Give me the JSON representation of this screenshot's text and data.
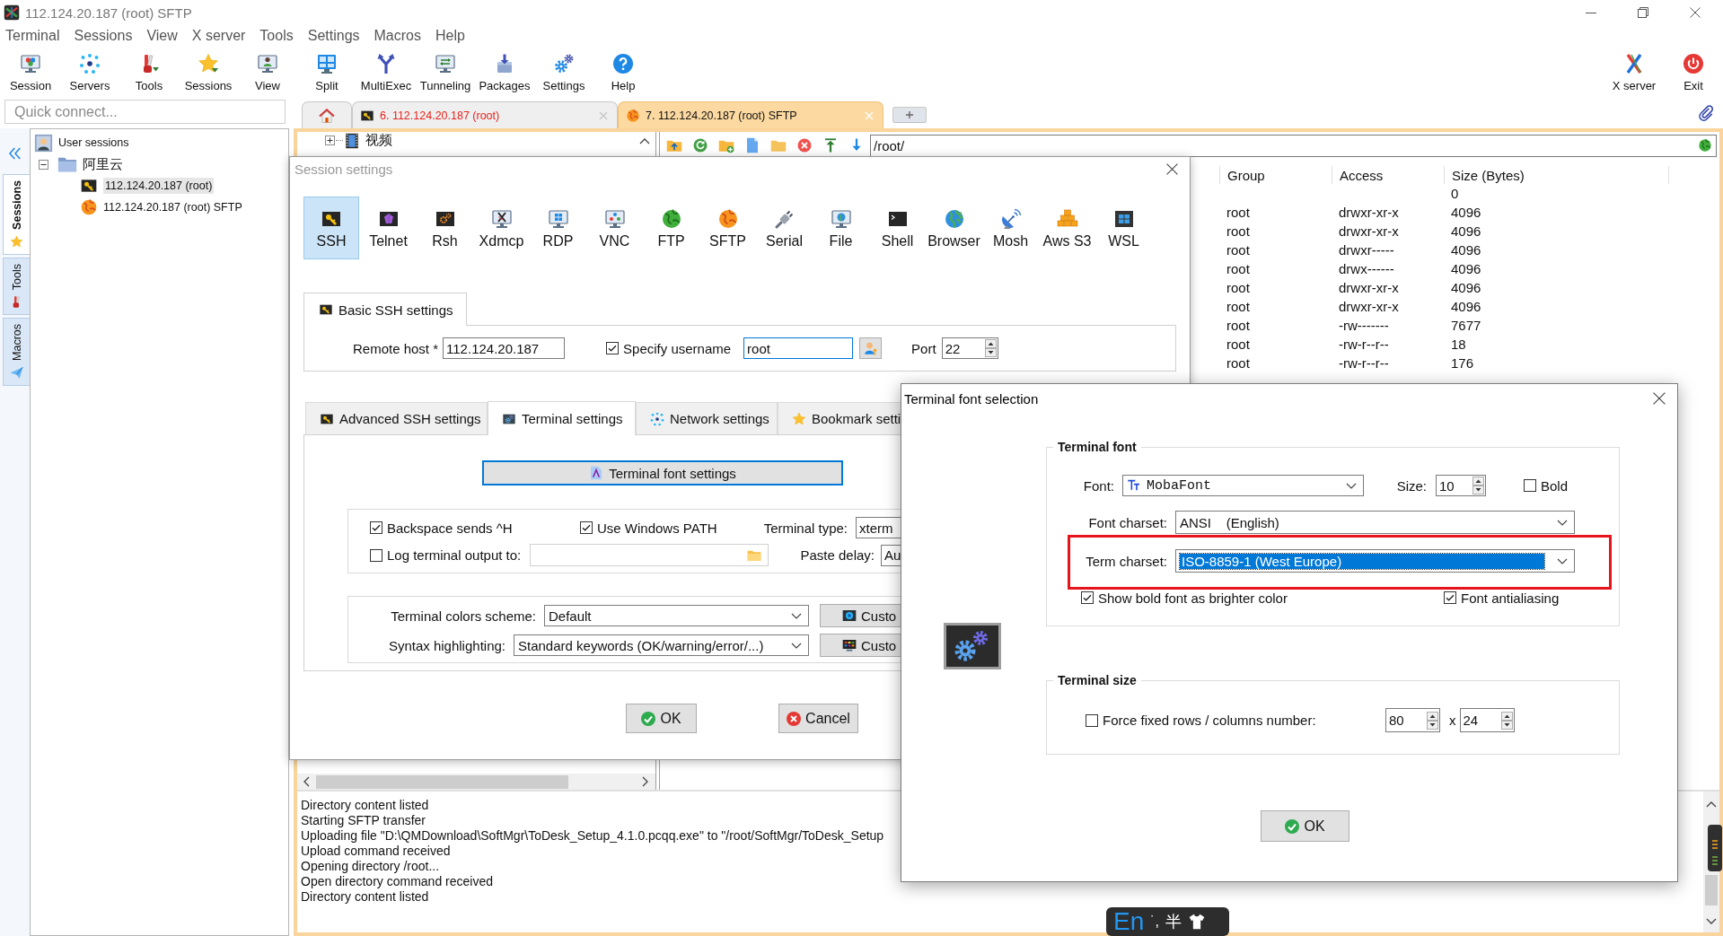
{
  "window": {
    "title": "112.124.20.187 (root) SFTP"
  },
  "menu": [
    "Terminal",
    "Sessions",
    "View",
    "X server",
    "Tools",
    "Settings",
    "Macros",
    "Help"
  ],
  "toolbar": [
    {
      "label": "Session",
      "kind": "session"
    },
    {
      "label": "Servers",
      "kind": "servers"
    },
    {
      "label": "Tools",
      "kind": "tools"
    },
    {
      "label": "Sessions",
      "kind": "sessions"
    },
    {
      "label": "View",
      "kind": "view"
    },
    {
      "label": "Split",
      "kind": "split"
    },
    {
      "label": "MultiExec",
      "kind": "multiexec"
    },
    {
      "label": "Tunneling",
      "kind": "tunneling"
    },
    {
      "label": "Packages",
      "kind": "packages"
    },
    {
      "label": "Settings",
      "kind": "settings"
    },
    {
      "label": "Help",
      "kind": "help"
    }
  ],
  "toolbar_right": [
    {
      "label": "X server",
      "kind": "xserver"
    },
    {
      "label": "Exit",
      "kind": "exit"
    }
  ],
  "quick_connect": {
    "placeholder": "Quick connect..."
  },
  "tabs": [
    {
      "kind": "home",
      "selected": false
    },
    {
      "kind": "ssh",
      "label": "6. 112.124.20.187 (root)",
      "color": "#e8231c",
      "selected": false
    },
    {
      "kind": "sftp",
      "label": "7. 112.124.20.187 (root) SFTP",
      "selected": true
    },
    {
      "kind": "new",
      "selected": false
    }
  ],
  "side_tabs": [
    {
      "label": "Sessions",
      "kind": "star",
      "selected": true
    },
    {
      "label": "Tools",
      "kind": "tools",
      "selected": false
    },
    {
      "label": "Macros",
      "kind": "plane",
      "selected": false
    }
  ],
  "sessions": [
    {
      "label": "User sessions",
      "kind": "group",
      "selected": false,
      "children": [
        {
          "label": "阿里云",
          "kind": "folder",
          "expanded": true,
          "selected": false,
          "children": [
            {
              "label": "112.124.20.187 (root)",
              "kind": "ssh",
              "selected": true
            },
            {
              "label": "112.124.20.187 (root) SFTP",
              "kind": "sftp",
              "selected": false
            }
          ]
        }
      ]
    }
  ],
  "file_browser": {
    "tree": [
      {
        "label": "视频",
        "expanded": false
      }
    ],
    "path": "/root/",
    "columns": [
      "Group",
      "Access",
      "Size (Bytes)"
    ],
    "rows": [
      {
        "size": "0"
      },
      {
        "group": "root",
        "access": "drwxr-xr-x",
        "size": "4096"
      },
      {
        "group": "root",
        "access": "drwxr-xr-x",
        "size": "4096"
      },
      {
        "group": "root",
        "access": "drwxr-----",
        "size": "4096"
      },
      {
        "group": "root",
        "access": "drwx------",
        "size": "4096"
      },
      {
        "group": "root",
        "access": "drwxr-xr-x",
        "size": "4096"
      },
      {
        "group": "root",
        "access": "drwxr-xr-x",
        "size": "4096"
      },
      {
        "group": "root",
        "access": "-rw-------",
        "size": "7677"
      },
      {
        "group": "root",
        "access": "-rw-r--r--",
        "size": "18"
      },
      {
        "group": "root",
        "access": "-rw-r--r--",
        "size": "176"
      }
    ]
  },
  "log": [
    "Directory content listed",
    "Starting SFTP transfer",
    "Uploading file \"D:\\QMDownload\\SoftMgr\\ToDesk_Setup_4.1.0.pcqq.exe\" to \"/root/SoftMgr/ToDesk_Setup",
    "Upload command received",
    "Opening directory /root...",
    "Open directory command received",
    "Directory content listed"
  ],
  "session_settings": {
    "title": "Session settings",
    "session_types": [
      {
        "label": "SSH",
        "kind": "ssh",
        "selected": true
      },
      {
        "label": "Telnet",
        "kind": "telnet",
        "selected": false
      },
      {
        "label": "Rsh",
        "kind": "rsh",
        "selected": false
      },
      {
        "label": "Xdmcp",
        "kind": "xdmcp",
        "selected": false
      },
      {
        "label": "RDP",
        "kind": "rdp",
        "selected": false
      },
      {
        "label": "VNC",
        "kind": "vnc",
        "selected": false
      },
      {
        "label": "FTP",
        "kind": "ftp",
        "selected": false
      },
      {
        "label": "SFTP",
        "kind": "sftp",
        "selected": false
      },
      {
        "label": "Serial",
        "kind": "serial",
        "selected": false
      },
      {
        "label": "File",
        "kind": "file",
        "selected": false
      },
      {
        "label": "Shell",
        "kind": "shell",
        "selected": false
      },
      {
        "label": "Browser",
        "kind": "browser",
        "selected": false
      },
      {
        "label": "Mosh",
        "kind": "mosh",
        "selected": false
      },
      {
        "label": "Aws S3",
        "kind": "awss3",
        "selected": false
      },
      {
        "label": "WSL",
        "kind": "wsl",
        "selected": false
      }
    ],
    "basic_tab": {
      "label": "Basic SSH settings"
    },
    "remote_host": {
      "label": "Remote host *",
      "value": "112.124.20.187"
    },
    "specify_username": {
      "label": "Specify username",
      "checked": true,
      "value": "root",
      "focused": true
    },
    "port": {
      "label": "Port",
      "value": "22"
    },
    "tabs": [
      {
        "label": "Advanced SSH settings",
        "kind": "ssh",
        "selected": false
      },
      {
        "label": "Terminal settings",
        "kind": "terminal",
        "selected": true
      },
      {
        "label": "Network settings",
        "kind": "network",
        "selected": false
      },
      {
        "label": "Bookmark setti",
        "kind": "bookmark",
        "selected": false
      }
    ],
    "font_button": {
      "label": "Terminal font settings",
      "focused": true
    },
    "options": [
      {
        "label": "Backspace sends ^H",
        "checked": true
      },
      {
        "label": "Use Windows PATH",
        "checked": true
      }
    ],
    "terminal_type": {
      "label": "Terminal type:",
      "value": "xterm"
    },
    "log_output": {
      "label": "Log terminal output to:",
      "checked": false
    },
    "paste_delay": {
      "label": "Paste delay:",
      "value": "Au"
    },
    "colors_scheme": {
      "label": "Terminal colors scheme:",
      "value": "Default",
      "button": "Custo"
    },
    "syntax": {
      "label": "Syntax highlighting:",
      "value": "Standard keywords (OK/warning/error/...)",
      "button": "Custo"
    },
    "buttons": [
      {
        "label": "OK",
        "kind": "ok"
      },
      {
        "label": "Cancel",
        "kind": "cancel"
      }
    ]
  },
  "font_dialog": {
    "title": "Terminal font selection",
    "font_group": {
      "title": "Terminal font",
      "font": {
        "label": "Font:",
        "value": "MobaFont"
      },
      "size": {
        "label": "Size:",
        "value": "10"
      },
      "bold": {
        "label": "Bold",
        "checked": false
      },
      "font_charset": {
        "label": "Font charset:",
        "value": "ANSI    (English)"
      },
      "term_charset": {
        "label": "Term charset:",
        "value": "ISO-8859-1 (West Europe)",
        "focused": true,
        "highlighted": true
      },
      "options": [
        {
          "label": "Show bold font as brighter color",
          "checked": true
        },
        {
          "label": "Font antialiasing",
          "checked": true
        }
      ]
    },
    "size_group": {
      "title": "Terminal size",
      "fixed": {
        "label": "Force fixed rows / columns number:",
        "checked": false
      },
      "rows": "80",
      "separator": "x",
      "columns": "24"
    },
    "ok": "OK"
  },
  "input_method": {
    "mode": "En",
    "punctuation": "˙,",
    "width": "半"
  }
}
